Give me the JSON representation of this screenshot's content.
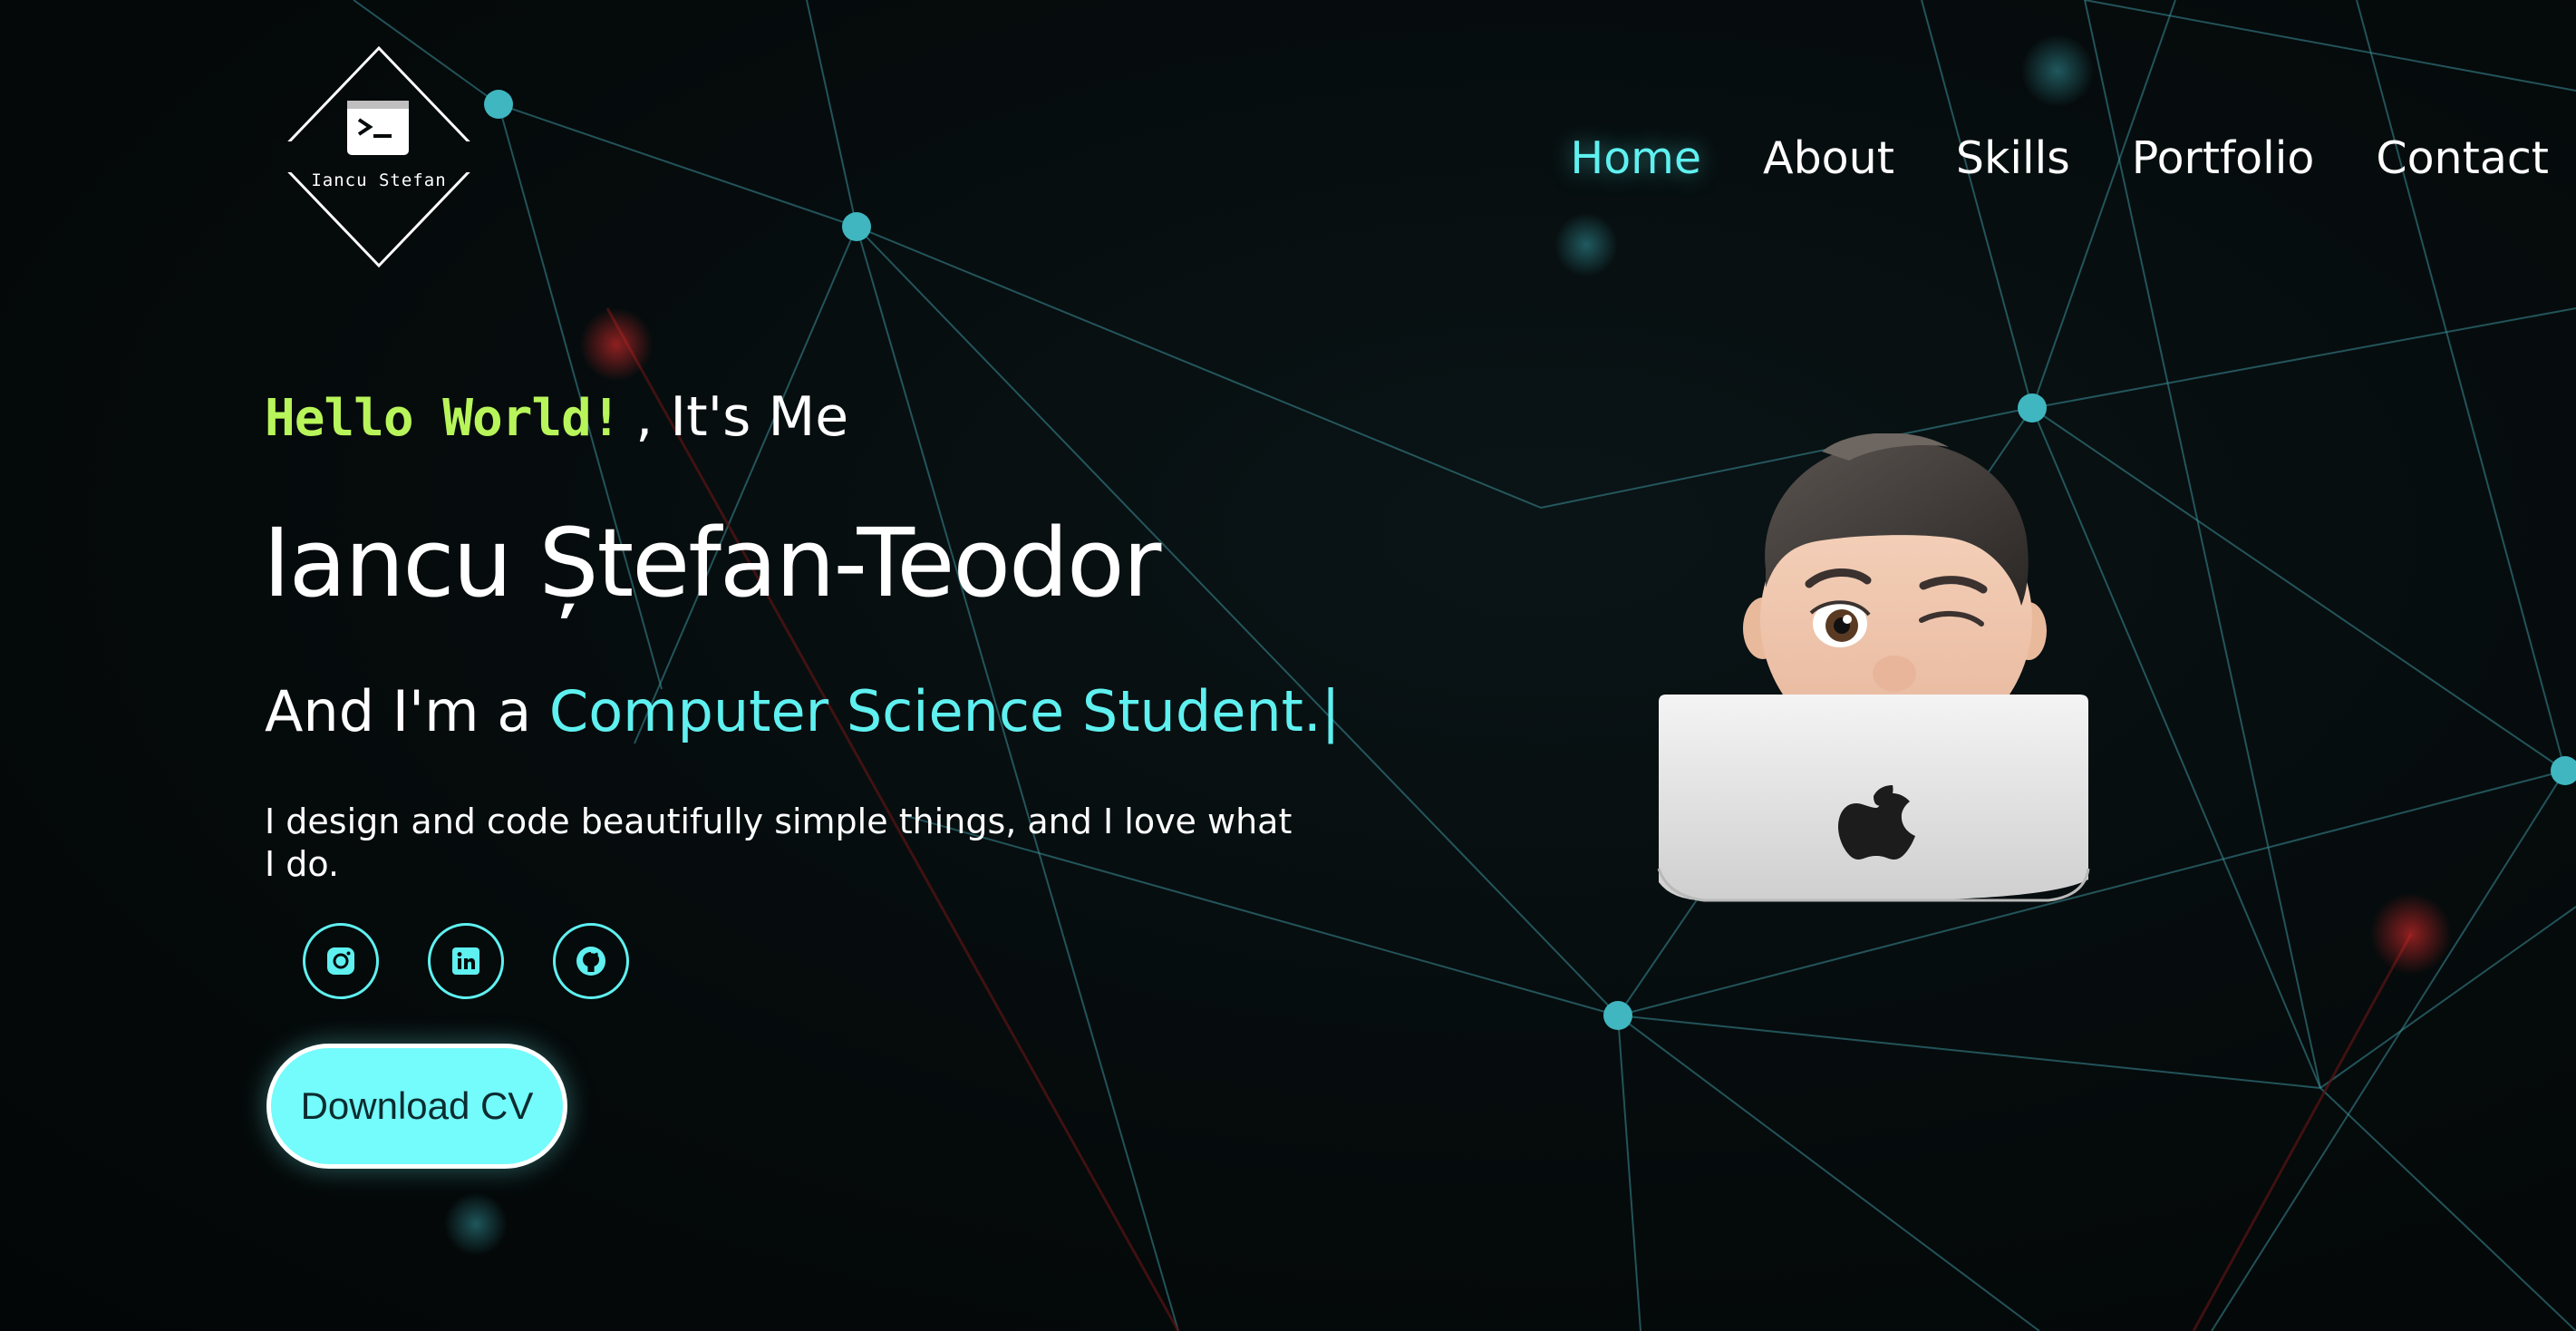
{
  "logo": {
    "text": "Iancu Stefan",
    "icon": "terminal-icon"
  },
  "nav": {
    "items": [
      {
        "label": "Home",
        "active": true
      },
      {
        "label": "About",
        "active": false
      },
      {
        "label": "Skills",
        "active": false
      },
      {
        "label": "Portfolio",
        "active": false
      },
      {
        "label": "Contact",
        "active": false
      }
    ]
  },
  "hero": {
    "hello": "Hello World!",
    "its_me": ", It's Me",
    "name": "Iancu Ștefan-Teodor",
    "role_prefix": "And I'm a ",
    "role_highlight": "Computer Science Student.",
    "role_cursor": "|",
    "description": "I design and code beautifully simple things, and I love what I do.",
    "cv_button": "Download CV"
  },
  "socials": [
    {
      "name": "instagram",
      "icon": "instagram-icon"
    },
    {
      "name": "linkedin",
      "icon": "linkedin-icon"
    },
    {
      "name": "github",
      "icon": "github-icon"
    }
  ],
  "colors": {
    "accent": "#5ff0f0",
    "hello": "#b8f55a",
    "button_bg": "#74fbfb",
    "background": "#050a0b"
  }
}
